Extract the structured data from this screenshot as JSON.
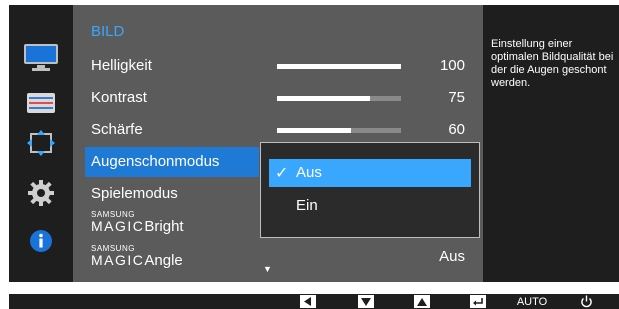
{
  "menu": {
    "title": "BILD",
    "items": [
      {
        "label": "Helligkeit",
        "value": "100",
        "level": 1.0
      },
      {
        "label": "Kontrast",
        "value": "75",
        "level": 0.75
      },
      {
        "label": "Schärfe",
        "value": "60",
        "level": 0.6
      },
      {
        "label": "Augenschonmodus"
      },
      {
        "label": "Spielemodus"
      },
      {
        "label_small": "SAMSUNG",
        "label_big": "MAGIC",
        "label_word": "Bright"
      },
      {
        "label_small": "SAMSUNG",
        "label_big": "MAGIC",
        "label_word": "Angle",
        "value": "Aus"
      }
    ],
    "more_indicator": "▼"
  },
  "dropdown": {
    "options": [
      {
        "label": "Aus",
        "checked": true
      },
      {
        "label": "Ein",
        "checked": false
      }
    ],
    "checkmark": "✓"
  },
  "help": {
    "text": "Einstellung einer optimalen Bildqualität bei der die Augen geschont werden."
  },
  "sidebar": {
    "icons": [
      "monitor-icon",
      "color-bars-icon",
      "resize-icon",
      "gear-icon",
      "info-icon"
    ]
  },
  "bottom_bar": {
    "auto_label": "AUTO",
    "buttons": [
      "left-arrow-icon",
      "down-arrow-icon",
      "up-arrow-icon",
      "enter-icon",
      "auto-button",
      "power-icon"
    ]
  },
  "colors": {
    "accent": "#3aa7ff",
    "selected_row": "#1f7ad6",
    "panel": "#5b5b5b",
    "dark": "#1e1e1e"
  }
}
